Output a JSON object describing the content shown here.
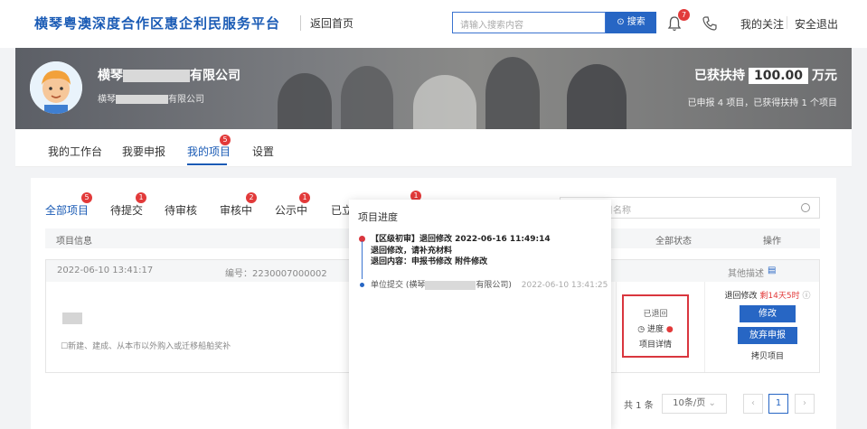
{
  "header": {
    "brand": "横琴粤澳深度合作区惠企利民服务平台",
    "home_link": "返回首页",
    "search_placeholder": "请输入搜索内容",
    "search_button": "搜索",
    "notification_count": "7",
    "my_follow": "我的关注",
    "logout": "安全退出"
  },
  "banner": {
    "company_prefix": "横琴",
    "company_suffix": "有限公司",
    "company_sub_prefix": "横琴",
    "company_sub_suffix": "有限公司",
    "support_label": "已获扶持",
    "support_amount": "100.00",
    "support_unit": "万元",
    "support_detail": "已申报 4 项目，已获得扶持 1 个项目"
  },
  "main_tabs": [
    {
      "label": "我的工作台"
    },
    {
      "label": "我要申报"
    },
    {
      "label": "我的项目",
      "badge": "5"
    },
    {
      "label": "设置"
    }
  ],
  "filter_tabs": [
    {
      "label": "全部项目",
      "badge": "5"
    },
    {
      "label": "待提交",
      "badge": "1"
    },
    {
      "label": "待审核"
    },
    {
      "label": "审核中",
      "badge": "2"
    },
    {
      "label": "公示中",
      "badge": "1"
    },
    {
      "label": "已立"
    }
  ],
  "hidden_badge": "1",
  "list_search_placeholder": "项目名称",
  "table": {
    "col_info": "项目信息",
    "col_status": "全部状态",
    "col_action": "操作"
  },
  "card": {
    "date": "2022-06-10 13:41:17",
    "number": "编号：2230007000002",
    "other_desc": "其他描述",
    "category": "新建、建成、从本市以外购入或迁移船舶奖补",
    "status_returned": "已退回",
    "status_progress": "进度",
    "status_detail": "项目详情",
    "deadline_label": "退回修改",
    "deadline_remaining": "剩14天5时",
    "btn_modify": "修改",
    "btn_abandon": "放弃申报",
    "copy_project": "拷贝项目"
  },
  "pager": {
    "total": "共 1 条",
    "page_size": "10条/页",
    "current_page": "1"
  },
  "popover": {
    "title": "项目进度",
    "entry1_head": "【区级初审】退回修改   2022-06-16 11:49:14",
    "entry1_line2": "退回修改，请补充材料",
    "entry1_line3": "退回内容：申报书修改 附件修改",
    "entry2_prefix": "单位提交 (横琴",
    "entry2_suffix": "有限公司)",
    "entry2_time": "2022-06-10 13:41:25"
  },
  "colors": {
    "brand_blue": "#1a5bb5",
    "button_blue": "#2766c4",
    "badge_red": "#e23a3a",
    "status_border": "#d9363e"
  }
}
